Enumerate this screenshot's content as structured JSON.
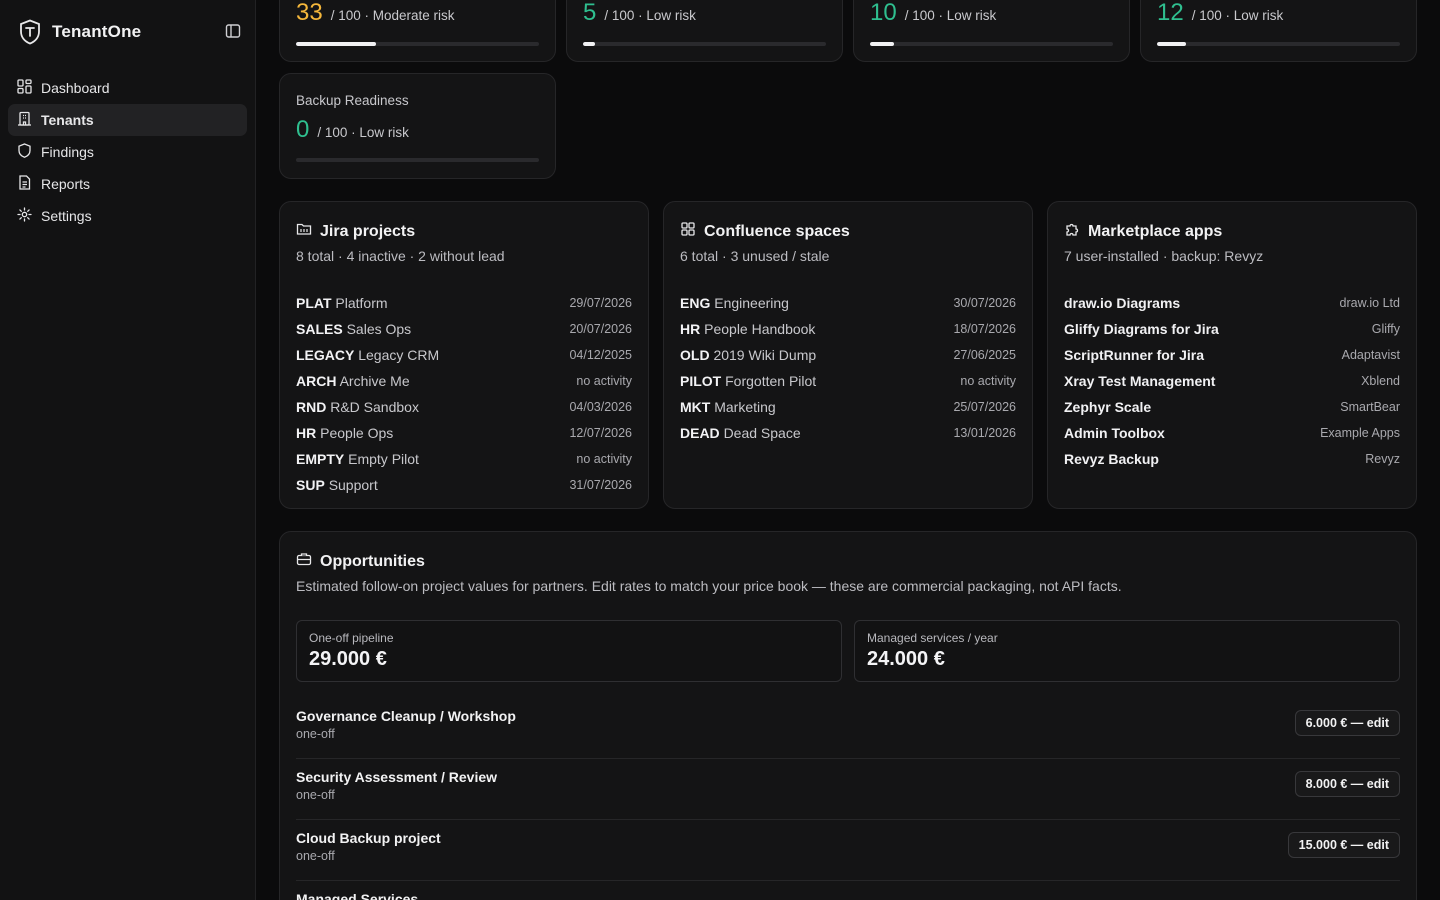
{
  "app": {
    "name": "TenantOne"
  },
  "nav": {
    "items": [
      {
        "label": "Dashboard",
        "icon": "dashboard-icon",
        "active": false
      },
      {
        "label": "Tenants",
        "icon": "building-icon",
        "active": true
      },
      {
        "label": "Findings",
        "icon": "shield-icon",
        "active": false
      },
      {
        "label": "Reports",
        "icon": "document-icon",
        "active": false
      },
      {
        "label": "Settings",
        "icon": "gear-icon",
        "active": false
      }
    ]
  },
  "scores": [
    {
      "value": "33",
      "suffix": "/ 100 · Moderate risk",
      "color": "#f5b73b",
      "percent": 33
    },
    {
      "value": "5",
      "suffix": "/ 100 · Low risk",
      "color": "#2fbf8f",
      "percent": 5
    },
    {
      "value": "10",
      "suffix": "/ 100 · Low risk",
      "color": "#2fbf8f",
      "percent": 10
    },
    {
      "value": "12",
      "suffix": "/ 100 · Low risk",
      "color": "#2fbf8f",
      "percent": 12
    },
    {
      "title": "Backup Readiness",
      "value": "0",
      "suffix": "/ 100 · Low risk",
      "color": "#2fbf8f",
      "percent": 0
    }
  ],
  "jira": {
    "title": "Jira projects",
    "summary": "8 total · 4 inactive · 2 without lead",
    "rows": [
      {
        "key": "PLAT",
        "name": "Platform",
        "date": "29/07/2026"
      },
      {
        "key": "SALES",
        "name": "Sales Ops",
        "date": "20/07/2026"
      },
      {
        "key": "LEGACY",
        "name": "Legacy CRM",
        "date": "04/12/2025"
      },
      {
        "key": "ARCH",
        "name": "Archive Me",
        "date": "no activity"
      },
      {
        "key": "RND",
        "name": "R&D Sandbox",
        "date": "04/03/2026"
      },
      {
        "key": "HR",
        "name": "People Ops",
        "date": "12/07/2026"
      },
      {
        "key": "EMPTY",
        "name": "Empty Pilot",
        "date": "no activity"
      },
      {
        "key": "SUP",
        "name": "Support",
        "date": "31/07/2026"
      }
    ]
  },
  "confluence": {
    "title": "Confluence spaces",
    "summary": "6 total · 3 unused / stale",
    "rows": [
      {
        "key": "ENG",
        "name": "Engineering",
        "date": "30/07/2026"
      },
      {
        "key": "HR",
        "name": "People Handbook",
        "date": "18/07/2026"
      },
      {
        "key": "OLD",
        "name": "2019 Wiki Dump",
        "date": "27/06/2025"
      },
      {
        "key": "PILOT",
        "name": "Forgotten Pilot",
        "date": "no activity"
      },
      {
        "key": "MKT",
        "name": "Marketing",
        "date": "25/07/2026"
      },
      {
        "key": "DEAD",
        "name": "Dead Space",
        "date": "13/01/2026"
      }
    ]
  },
  "marketplace": {
    "title": "Marketplace apps",
    "summary": "7 user-installed · backup: Revyz",
    "rows": [
      {
        "name": "draw.io Diagrams",
        "vendor": "draw.io Ltd"
      },
      {
        "name": "Gliffy Diagrams for Jira",
        "vendor": "Gliffy"
      },
      {
        "name": "ScriptRunner for Jira",
        "vendor": "Adaptavist"
      },
      {
        "name": "Xray Test Management",
        "vendor": "Xblend"
      },
      {
        "name": "Zephyr Scale",
        "vendor": "SmartBear"
      },
      {
        "name": "Admin Toolbox",
        "vendor": "Example Apps"
      },
      {
        "name": "Revyz Backup",
        "vendor": "Revyz"
      }
    ]
  },
  "opportunities": {
    "title": "Opportunities",
    "description": "Estimated follow-on project values for partners. Edit rates to match your price book — these are commercial packaging, not API facts.",
    "stats": [
      {
        "label": "One-off pipeline",
        "value": "29.000 €"
      },
      {
        "label": "Managed services / year",
        "value": "24.000 €"
      }
    ],
    "items": [
      {
        "name": "Governance Cleanup / Workshop",
        "type": "one-off",
        "button": "6.000 € — edit"
      },
      {
        "name": "Security Assessment / Review",
        "type": "one-off",
        "button": "8.000 € — edit"
      },
      {
        "name": "Cloud Backup project",
        "type": "one-off",
        "button": "15.000 € — edit"
      },
      {
        "name": "Managed Services",
        "type": "",
        "button": ""
      }
    ]
  }
}
